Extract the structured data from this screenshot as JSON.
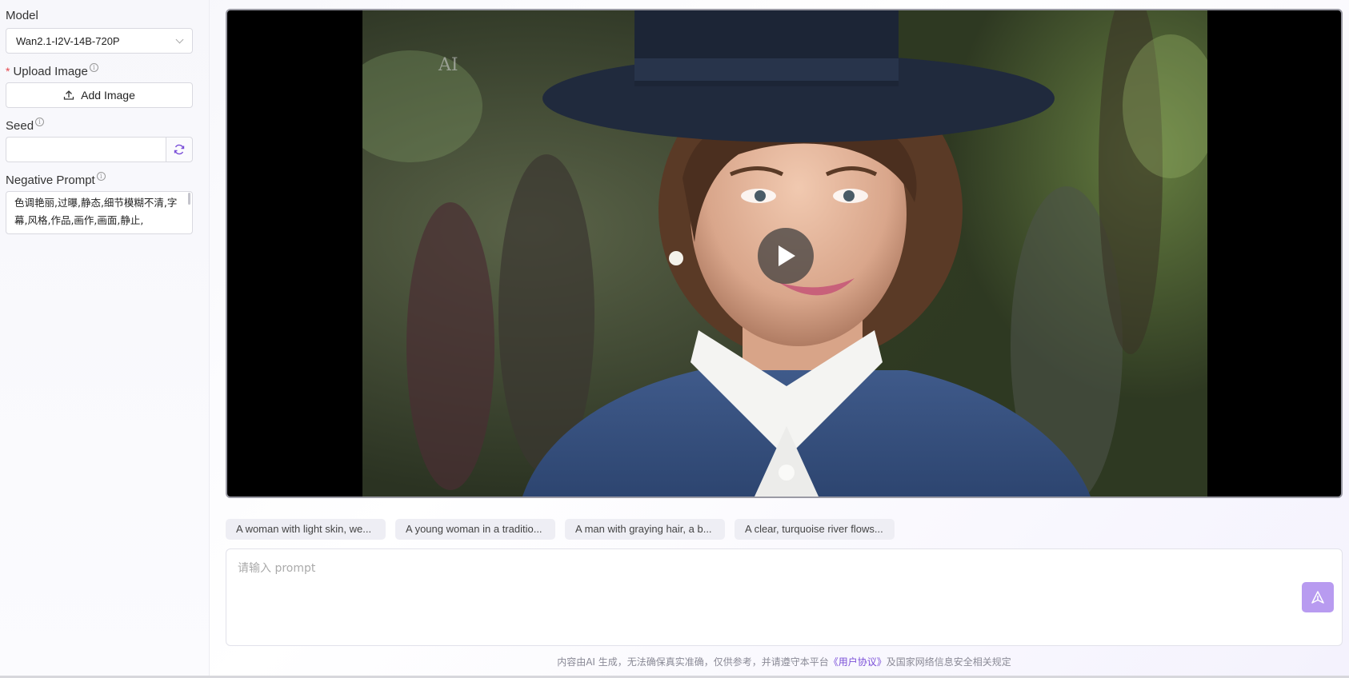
{
  "sidebar": {
    "model": {
      "label": "Model",
      "value": "Wan2.1-I2V-14B-720P"
    },
    "upload": {
      "required_mark": "*",
      "label": "Upload Image",
      "button_label": "Add Image"
    },
    "seed": {
      "label": "Seed",
      "value": ""
    },
    "negative_prompt": {
      "label": "Negative Prompt",
      "value": "色调艳丽,过曝,静态,细节模糊不清,字幕,风格,作品,画作,画面,静止,"
    }
  },
  "video": {
    "state": "paused",
    "play_icon": "play-icon"
  },
  "suggestions": [
    "A woman with light skin, we...",
    "A young woman in a traditio...",
    "A man with graying hair, a b...",
    "A clear, turquoise river flows..."
  ],
  "prompt": {
    "placeholder": "请输入 prompt",
    "value": ""
  },
  "footer": {
    "text_before": "内容由AI 生成，无法确保真实准确，仅供参考，并请遵守本平台",
    "link": "《用户协议》",
    "text_after": "及国家网络信息安全相关规定"
  },
  "colors": {
    "accent": "#b89bf0",
    "link": "#7a4fd8",
    "required": "#e5484d"
  }
}
